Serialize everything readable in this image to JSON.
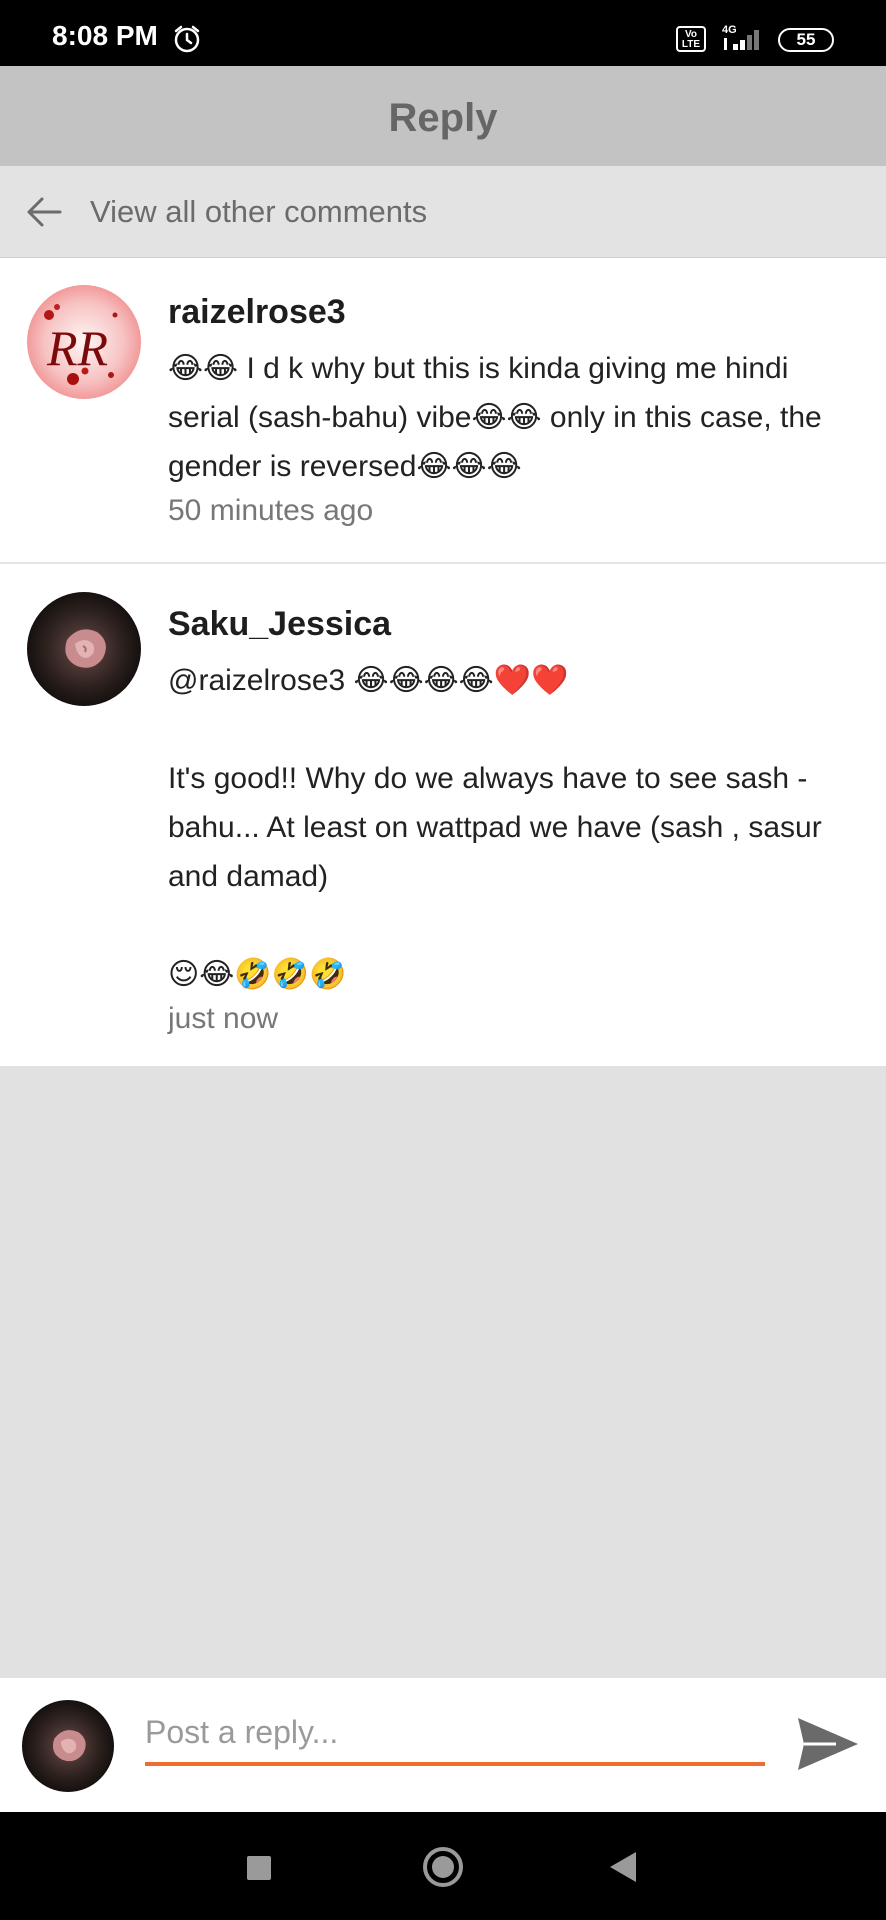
{
  "status_bar": {
    "time": "8:08 PM",
    "volte": "Vo LTE",
    "network": "4G",
    "battery": "55"
  },
  "header": {
    "title": "Reply"
  },
  "nav": {
    "back_label": "View all other comments"
  },
  "comments": [
    {
      "username": "raizelrose3",
      "avatar_text": "RR",
      "text": "😂😂 I d k why but this is kinda giving me hindi serial (sash-bahu) vibe😂😂 only in this case, the gender is reversed😂😂😂",
      "time": "50 minutes ago"
    },
    {
      "username": "Saku_Jessica",
      "text": "@raizelrose3 😂😂😂😂❤️❤️\n\nIt's good!! Why do we always have to see sash - bahu... At least on wattpad we have (sash , sasur and damad)\n\n😌😂🤣🤣🤣",
      "time": "just now"
    }
  ],
  "reply": {
    "placeholder": "Post a reply..."
  },
  "colors": {
    "accent": "#ef6c2e",
    "header_bg": "#c3c3c3",
    "empty_bg": "#e1e1e1"
  }
}
